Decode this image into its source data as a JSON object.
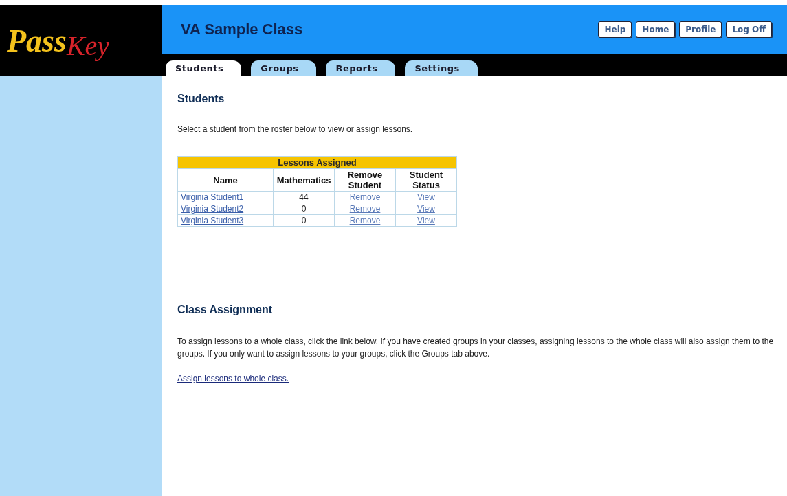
{
  "logo": {
    "part_1": "Pass",
    "part_2": "Key"
  },
  "header": {
    "title": "VA Sample Class",
    "buttons": [
      "Help",
      "Home",
      "Profile",
      "Log Off"
    ]
  },
  "tabs": [
    {
      "label": "Students",
      "selected": true
    },
    {
      "label": "Groups",
      "selected": false
    },
    {
      "label": "Reports",
      "selected": false
    },
    {
      "label": "Settings",
      "selected": false
    }
  ],
  "students": {
    "heading": "Students",
    "intro": "Select a student from the roster below to view or assign lessons.",
    "table": {
      "caption": "Lessons Assigned",
      "columns": [
        "Name",
        "Mathematics",
        "Remove Student",
        "Student Status"
      ],
      "rows": [
        {
          "name": "Virginia Student1",
          "mathematics": "44",
          "remove": "Remove",
          "status": "View"
        },
        {
          "name": "Virginia Student2",
          "mathematics": "0",
          "remove": "Remove",
          "status": "View"
        },
        {
          "name": "Virginia Student3",
          "mathematics": "0",
          "remove": "Remove",
          "status": "View"
        }
      ]
    }
  },
  "class_assignment": {
    "heading": "Class Assignment",
    "text": "To assign lessons to a whole class, click the link below. If you have created groups in your classes, assigning lessons to the whole class will also assign them to the groups. If you only want to assign lessons to your groups, click the Groups tab above.",
    "link": "Assign lessons to whole class."
  }
}
